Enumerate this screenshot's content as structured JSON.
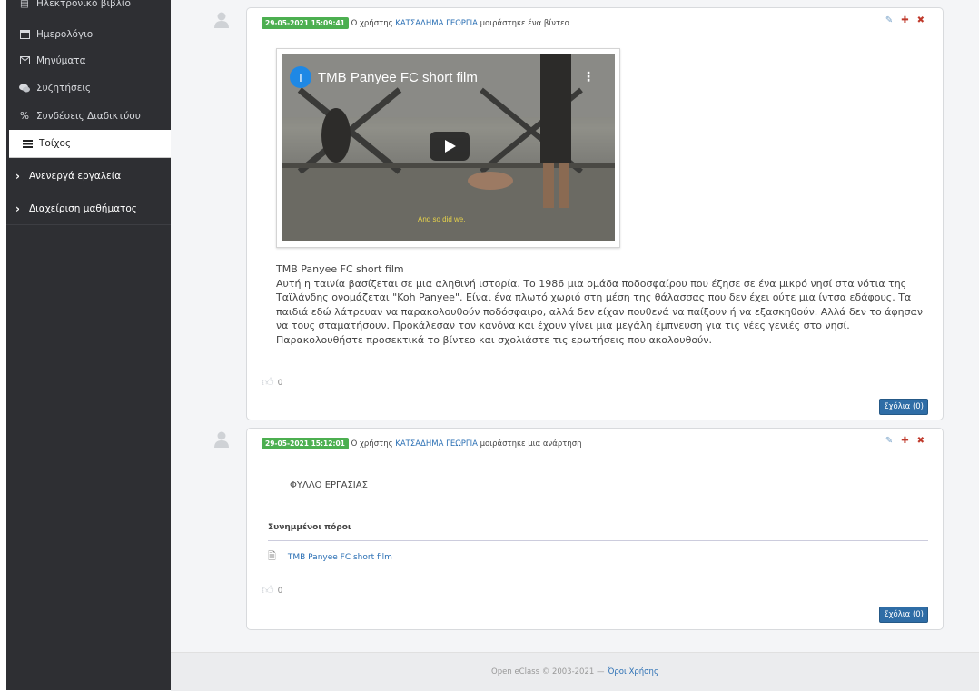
{
  "sidebar": {
    "items": [
      {
        "label": "Ηλεκτρονικό βιβλίο",
        "icon": "book-icon"
      },
      {
        "label": "Ημερολόγιο",
        "icon": "calendar-icon"
      },
      {
        "label": "Μηνύματα",
        "icon": "envelope-icon"
      },
      {
        "label": "Συζητήσεις",
        "icon": "comments-icon"
      },
      {
        "label": "Συνδέσεις Διαδικτύου",
        "icon": "link-icon"
      },
      {
        "label": "Τοίχος",
        "icon": "list-icon"
      }
    ],
    "categories": [
      {
        "label": "Ανενεργά εργαλεία"
      },
      {
        "label": "Διαχείριση μαθήματος"
      }
    ]
  },
  "posts": [
    {
      "date": "29-05-2021 15:09:41",
      "prefix": "Ο χρήστης",
      "user": "ΚΑΤΣΑΔΗΜΑ ΓΕΩΡΓΙΑ",
      "action": "μοιράστηκε ένα βίντεο",
      "video": {
        "title": "TMB Panyee FC short film",
        "logo_letter": "T",
        "subtitle": "And so did we."
      },
      "text_title": "TMB Panyee FC short film",
      "text_body": "Αυτή η ταινία βασίζεται σε μια αληθινή ιστορία. Το 1986 μια ομάδα ποδοσφαίρου που έζησε σε ένα μικρό νησί στα νότια της Ταϊλάνδης ονομάζεται \"Koh Panyee\". Είναι ένα πλωτό χωριό στη μέση της θάλασσας που δεν έχει ούτε μια ίντσα εδάφους. Τα παιδιά εδώ λάτρευαν να παρακολουθούν ποδόσφαιρο, αλλά δεν είχαν πουθενά να παίξουν ή να εξασκηθούν. Αλλά δεν το άφησαν να τους σταματήσουν. Προκάλεσαν τον κανόνα και έχουν γίνει μια μεγάλη έμπνευση για τις νέες γενιές στο νησί.",
      "text_footer": "Παρακολουθήστε προσεκτικά το βίντεο και σχολιάστε τις ερωτήσεις που ακολουθούν.",
      "likes": "0",
      "comments": "Σχόλια (0)"
    },
    {
      "date": "29-05-2021 15:12:01",
      "prefix": "Ο χρήστης",
      "user": "ΚΑΤΣΑΔΗΜΑ ΓΕΩΡΓΙΑ",
      "action": "μοιράστηκε μια ανάρτηση",
      "body": "ΦΥΛΛΟ ΕΡΓΑΣΙΑΣ",
      "resources_title": "Συνημμένοι πόροι",
      "resource": "TMB Panyee FC short film",
      "likes": "0",
      "comments": "Σχόλια (0)"
    }
  ],
  "footer": {
    "copyright": "Open eClass © 2003-2021 —",
    "terms": "Όροι Χρήσης"
  },
  "colors": {
    "sidebar_bg": "#2e2f33",
    "badge": "#4caf50",
    "link": "#2a6fb4",
    "button": "#2f6da6",
    "danger": "#c0392b"
  }
}
